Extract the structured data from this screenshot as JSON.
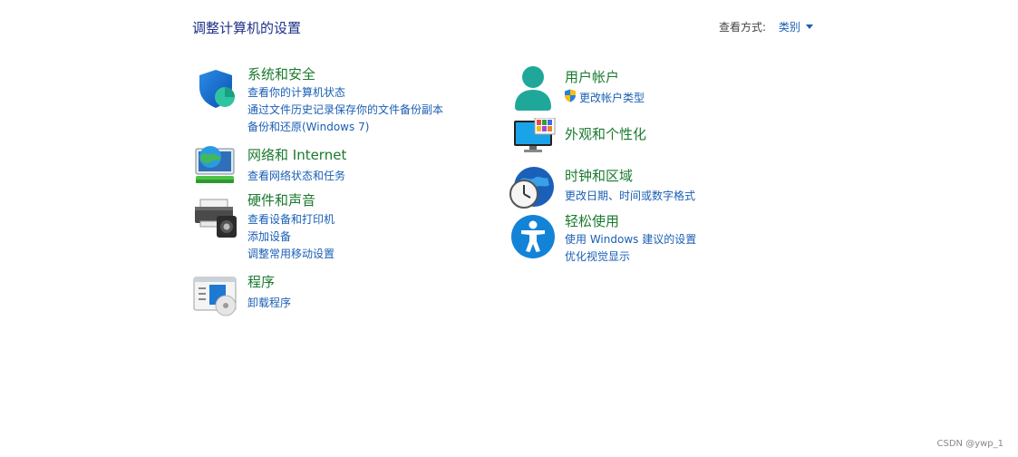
{
  "header": {
    "title": "调整计算机的设置",
    "view_by_label": "查看方式:",
    "view_by_value": "类别"
  },
  "categories": {
    "system": {
      "title": "系统和安全",
      "links": [
        "查看你的计算机状态",
        "通过文件历史记录保存你的文件备份副本",
        "备份和还原(Windows 7)"
      ]
    },
    "network": {
      "title": "网络和 Internet",
      "links": [
        "查看网络状态和任务"
      ]
    },
    "hardware": {
      "title": "硬件和声音",
      "links": [
        "查看设备和打印机",
        "添加设备",
        "调整常用移动设置"
      ]
    },
    "programs": {
      "title": "程序",
      "links": [
        "卸载程序"
      ]
    },
    "accounts": {
      "title": "用户帐户",
      "links": [
        "更改帐户类型"
      ]
    },
    "appearance": {
      "title": "外观和个性化",
      "links": []
    },
    "clock": {
      "title": "时钟和区域",
      "links": [
        "更改日期、时间或数字格式"
      ]
    },
    "ease": {
      "title": "轻松使用",
      "links": [
        "使用 Windows 建议的设置",
        "优化视觉显示"
      ]
    }
  },
  "watermark": "CSDN @ywp_1"
}
